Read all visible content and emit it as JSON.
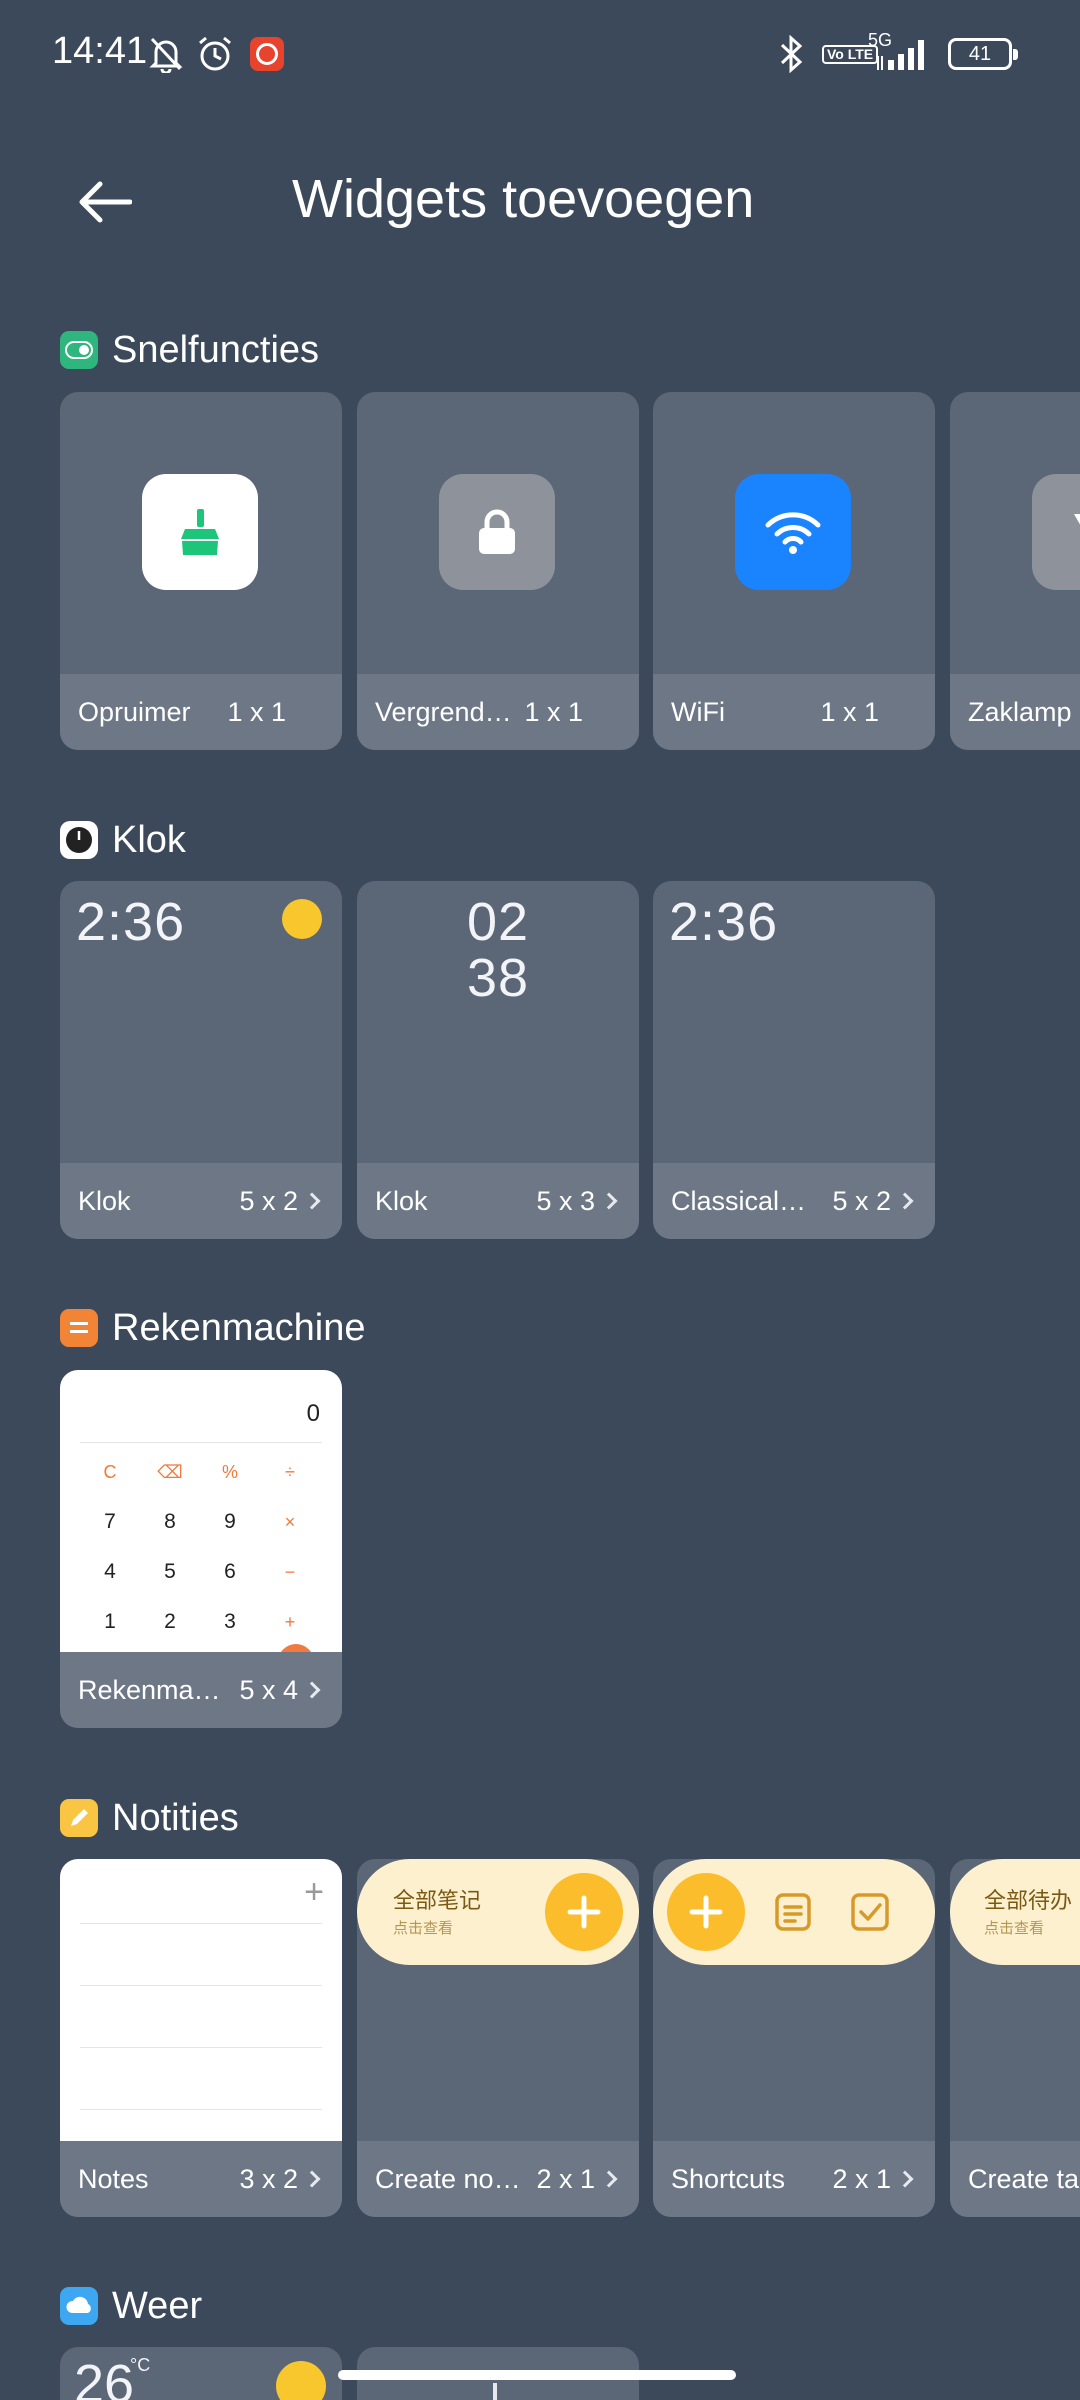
{
  "status_bar": {
    "time": "14:41",
    "network": "5G",
    "volte": "Vo LTE",
    "battery": "41"
  },
  "header": {
    "title": "Widgets toevoegen"
  },
  "sections": {
    "snelfuncties": {
      "label": "Snelfuncties",
      "cards": [
        {
          "name": "Opruimer",
          "size": "1 x 1",
          "icon": "broom-icon",
          "color": "#ffffff"
        },
        {
          "name": "Vergrende…",
          "size": "1 x 1",
          "icon": "lock-icon",
          "color": "#8e939b"
        },
        {
          "name": "WiFi",
          "size": "1 x 1",
          "icon": "wifi-icon",
          "color": "#1a84ff"
        },
        {
          "name": "Zaklamp",
          "size": "",
          "icon": "flashlight-icon",
          "color": "#8e939b"
        }
      ]
    },
    "klok": {
      "label": "Klok",
      "cards": [
        {
          "name": "Klok",
          "size": "5 x 2",
          "time": "2:36"
        },
        {
          "name": "Klok",
          "size": "5 x 3",
          "hour": "02",
          "minute": "38"
        },
        {
          "name": "Classical…",
          "size": "5 x 2",
          "time": "2:36"
        }
      ]
    },
    "rekenmachine": {
      "label": "Rekenmachine",
      "display": "0",
      "keys": [
        "C",
        "⌫",
        "%",
        "÷",
        "7",
        "8",
        "9",
        "×",
        "4",
        "5",
        "6",
        "−",
        "1",
        "2",
        "3",
        "+"
      ],
      "cards": [
        {
          "name": "Rekenma…",
          "size": "5 x 4"
        }
      ]
    },
    "notities": {
      "label": "Notities",
      "all_notes_title": "全部笔记",
      "all_notes_sub": "点击查看",
      "all_todos_title": "全部待办",
      "all_todos_sub": "点击查看",
      "cards": [
        {
          "name": "Notes",
          "size": "3 x 2"
        },
        {
          "name": "Create no…",
          "size": "2 x 1"
        },
        {
          "name": "Shortcuts",
          "size": "2 x 1"
        },
        {
          "name": "Create ta",
          "size": ""
        }
      ]
    },
    "weer": {
      "label": "Weer",
      "temp": "26",
      "unit": "°C"
    }
  },
  "colors": {
    "background": "#3c495a",
    "card": "#5b6677",
    "accent_yellow": "#fbbd2b",
    "accent_orange": "#f28435"
  }
}
